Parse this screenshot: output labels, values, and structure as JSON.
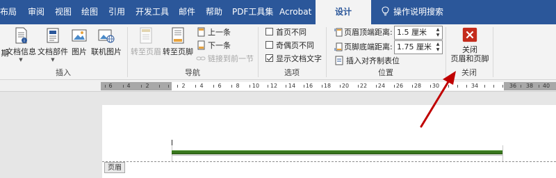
{
  "tabs": [
    {
      "label": "布局"
    },
    {
      "label": "审阅"
    },
    {
      "label": "视图"
    },
    {
      "label": "绘图"
    },
    {
      "label": "引用"
    },
    {
      "label": "开发工具"
    },
    {
      "label": "邮件"
    },
    {
      "label": "帮助"
    },
    {
      "label": "PDF工具集"
    },
    {
      "label": "Acrobat"
    },
    {
      "label": "设计"
    }
  ],
  "tell_me": "操作说明搜索",
  "ribbon": {
    "insert_group": {
      "label": "插入",
      "buttons": [
        {
          "label": "期",
          "icon": "date-time-icon"
        },
        {
          "label": "文档信息",
          "icon": "document-info-icon"
        },
        {
          "label": "文档部件",
          "icon": "quick-parts-icon"
        },
        {
          "label": "图片",
          "icon": "picture-icon"
        },
        {
          "label": "联机图片",
          "icon": "online-picture-icon"
        }
      ]
    },
    "nav_group": {
      "label": "导航",
      "goto_header": "转至页眉",
      "goto_footer": "转至页脚",
      "previous": "上一条",
      "next": "下一条",
      "link_previous": "链接到前一节"
    },
    "options_group": {
      "label": "选项",
      "options": [
        {
          "label": "首页不同",
          "checked": false
        },
        {
          "label": "奇偶页不同",
          "checked": false
        },
        {
          "label": "显示文档文字",
          "checked": true
        }
      ]
    },
    "position_group": {
      "label": "位置",
      "header_top_label": "页眉顶端距离:",
      "header_top_value": "1.5 厘米",
      "footer_bottom_label": "页脚底端距离:",
      "footer_bottom_value": "1.75 厘米",
      "insert_align_tab": "插入对齐制表位"
    },
    "close_group": {
      "label": "关闭",
      "close_line1": "关闭",
      "close_line2": "页眉和页脚"
    }
  },
  "ruler": {
    "labels": [
      "6",
      "4",
      "2",
      "2",
      "4",
      "6",
      "8",
      "10",
      "12",
      "14",
      "16",
      "18",
      "20",
      "22",
      "24",
      "26",
      "28",
      "30",
      "34",
      "36",
      "38",
      "40"
    ]
  },
  "document": {
    "header_tag": "页眉"
  },
  "colors": {
    "tab_bar": "#2b579a",
    "active_tab": "#f3f3f3",
    "close_icon": "#c42b1c",
    "header_line": "#38761d",
    "annotation_arrow": "#c00000"
  }
}
